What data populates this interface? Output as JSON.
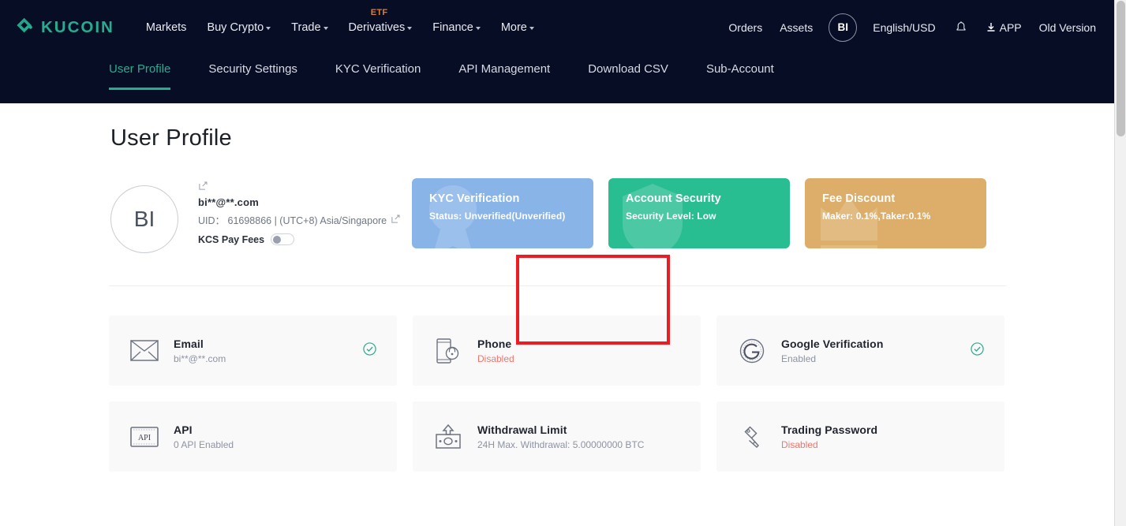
{
  "header": {
    "brand": "KUCOIN",
    "nav": [
      {
        "label": "Markets",
        "caret": false,
        "badge": ""
      },
      {
        "label": "Buy Crypto",
        "caret": true,
        "badge": ""
      },
      {
        "label": "Trade",
        "caret": true,
        "badge": ""
      },
      {
        "label": "Derivatives",
        "caret": true,
        "badge": "ETF"
      },
      {
        "label": "Finance",
        "caret": true,
        "badge": ""
      },
      {
        "label": "More",
        "caret": true,
        "badge": ""
      }
    ],
    "right": {
      "orders": "Orders",
      "assets": "Assets",
      "avatar_initials": "BI",
      "language_currency": "English/USD",
      "bell_icon": "bell-icon",
      "app_label": "APP",
      "app_icon": "download-icon",
      "old_version": "Old Version"
    }
  },
  "subnav": {
    "tabs": [
      {
        "label": "User Profile",
        "active": true
      },
      {
        "label": "Security Settings",
        "active": false
      },
      {
        "label": "KYC Verification",
        "active": false
      },
      {
        "label": "API Management",
        "active": false
      },
      {
        "label": "Download CSV",
        "active": false
      },
      {
        "label": "Sub-Account",
        "active": false
      }
    ]
  },
  "main": {
    "page_title": "User Profile",
    "profile": {
      "avatar_initials": "BI",
      "email": "bi**@**.com",
      "uid_line": "UID： 61698866 | (UTC+8) Asia/Singapore",
      "kcs_pay_fees_label": "KCS Pay Fees",
      "kcs_pay_fees_on": false,
      "edit_icon": "edit-pencil-icon"
    },
    "stat_cards": [
      {
        "key": "kyc",
        "title": "KYC Verification",
        "subtitle": "Status: Unverified(Unverified)",
        "color": "#89b4e8",
        "highlighted": true
      },
      {
        "key": "security",
        "title": "Account Security",
        "subtitle": "Security Level: Low",
        "color": "#29bd92",
        "highlighted": false
      },
      {
        "key": "fee",
        "title": "Fee Discount",
        "subtitle": "Maker: 0.1%,Taker:0.1%",
        "color": "#ddae6a",
        "highlighted": false
      }
    ],
    "annotation": {
      "type": "red-highlight-box",
      "target": "KYC Verification",
      "color": "#ef1b22"
    },
    "info_cards": [
      {
        "icon": "envelope-icon",
        "title": "Email",
        "subtitle": "bi**@**.com",
        "subtitle_state": "normal",
        "status_icon": "check-circle-icon",
        "status_color": "#24ae8f"
      },
      {
        "icon": "phone-lock-icon",
        "title": "Phone",
        "subtitle": "Disabled",
        "subtitle_state": "danger",
        "status_icon": "",
        "status_color": ""
      },
      {
        "icon": "google-authenticator-icon",
        "title": "Google Verification",
        "subtitle": "Enabled",
        "subtitle_state": "normal",
        "status_icon": "check-circle-icon",
        "status_color": "#24ae8f"
      },
      {
        "icon": "api-icon",
        "title": "API",
        "subtitle": "0 API Enabled",
        "subtitle_state": "normal",
        "status_icon": "",
        "status_color": ""
      },
      {
        "icon": "withdrawal-icon",
        "title": "Withdrawal Limit",
        "subtitle": "24H Max. Withdrawal: 5.00000000 BTC",
        "subtitle_state": "normal",
        "status_icon": "",
        "status_color": ""
      },
      {
        "icon": "key-icon",
        "title": "Trading Password",
        "subtitle": "Disabled",
        "subtitle_state": "danger",
        "status_icon": "",
        "status_color": ""
      }
    ]
  }
}
